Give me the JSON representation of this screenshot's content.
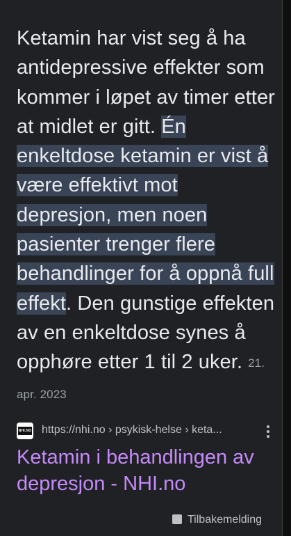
{
  "snippet": {
    "text_before": "Ketamin har vist seg å ha antidepressive effekter som kommer i løpet av timer etter at midlet er gitt. ",
    "highlighted": "Én enkeltdose ketamin er vist å være effektivt mot depresjon, men noen pasienter trenger flere behandlinger for å oppnå full effekt",
    "text_after": ". Den gunstige effekten av en enkeltdose synes å opphøre etter 1 til 2 uker.",
    "date": "21. apr. 2023"
  },
  "source": {
    "favicon_text": "NHI.NO",
    "url": "https://nhi.no › psykisk-helse › keta...",
    "title": "Ketamin i behandlingen av depresjon - NHI.no"
  },
  "footer": {
    "feedback_label": "Tilbakemelding"
  },
  "colors": {
    "background": "#202124",
    "text": "#e8eaed",
    "highlight": "#394457",
    "link": "#c58af9",
    "muted": "#9aa0a6"
  }
}
